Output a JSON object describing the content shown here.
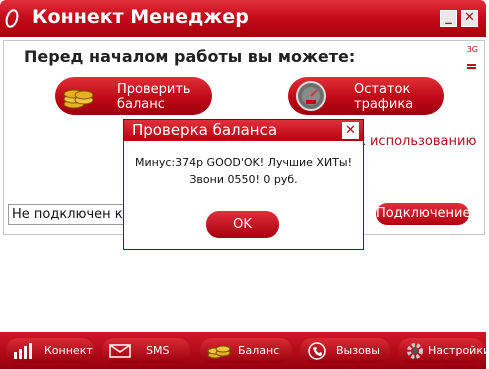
{
  "window": {
    "title": "Коннект Менеджер",
    "minimize_label": "_",
    "close_label": "✕"
  },
  "main": {
    "headline": "Перед началом работы вы можете:",
    "network_indicator": "3G",
    "check_balance_label": "Проверить баланс",
    "check_balance_line1": "Проверить",
    "check_balance_line2": "баланс",
    "traffic_line1": "Остаток",
    "traffic_line2": "трафика",
    "ready_text": "к использованию",
    "status_value": "Не подключен к 3",
    "connect_label": "Подключение"
  },
  "dialog": {
    "title": "Проверка баланса",
    "message_line1": "Минус:374р GOOD'OK! Лучшие ХИТы!",
    "message_line2": "Звони 0550! 0 руб.",
    "ok_label": "OK",
    "close_label": "✕"
  },
  "nav": {
    "items": [
      {
        "label": "Коннект",
        "icon": "signal-bars-icon"
      },
      {
        "label": "SMS",
        "icon": "envelope-icon"
      },
      {
        "label": "Баланс",
        "icon": "coins-icon"
      },
      {
        "label": "Вызовы",
        "icon": "phone-icon"
      },
      {
        "label": "Настройки",
        "icon": "gear-icon"
      }
    ]
  },
  "colors": {
    "brand_red": "#c80c1c",
    "dark_red": "#9c0010",
    "accent_gold": "#e8b020"
  }
}
